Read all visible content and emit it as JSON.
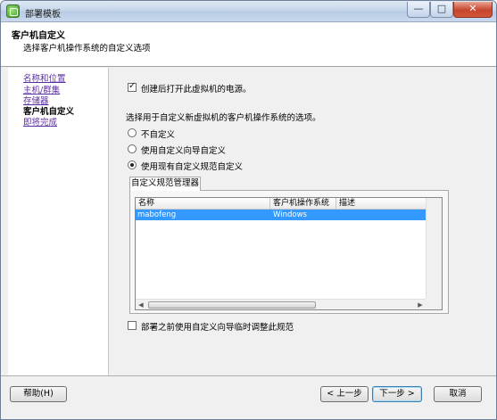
{
  "window": {
    "title": "部署模板",
    "controls": {
      "minimize": "—",
      "maximize": "□",
      "close": "✕"
    }
  },
  "header": {
    "title": "客户机自定义",
    "subtitle": "选择客户机操作系统的自定义选项"
  },
  "nav": {
    "items": [
      {
        "label": "名称和位置",
        "state": "visited"
      },
      {
        "label": "主机/群集",
        "state": "visited"
      },
      {
        "label": "存储器",
        "state": "visited"
      },
      {
        "label": "客户机自定义",
        "state": "current"
      },
      {
        "label": "即将完成",
        "state": "visited"
      }
    ]
  },
  "main": {
    "power_on": {
      "label": "创建后打开此虚拟机的电源。",
      "checked": true
    },
    "prompt": "选择用于自定义新虚拟机的客户机操作系统的选项。",
    "options": [
      {
        "label": "不自定义",
        "selected": false
      },
      {
        "label": "使用自定义向导自定义",
        "selected": false
      },
      {
        "label": "使用现有自定义规范自定义",
        "selected": true
      }
    ],
    "tab_label": "自定义规范管理器",
    "table": {
      "columns": [
        "名称",
        "客户机操作系统",
        "描述"
      ],
      "rows": [
        {
          "name": "mabofeng",
          "os": "Windows",
          "desc": ""
        }
      ]
    },
    "adjust": {
      "label": "部署之前使用自定义向导临时调整此规范",
      "checked": false
    }
  },
  "footer": {
    "help_label": "帮助(H)",
    "back_label": "< 上一步",
    "next_label": "下一步 >",
    "cancel_label": "取消"
  },
  "colors": {
    "selection": "#3399ff",
    "link": "#5a2fa0",
    "close_button": "#c7452b"
  }
}
